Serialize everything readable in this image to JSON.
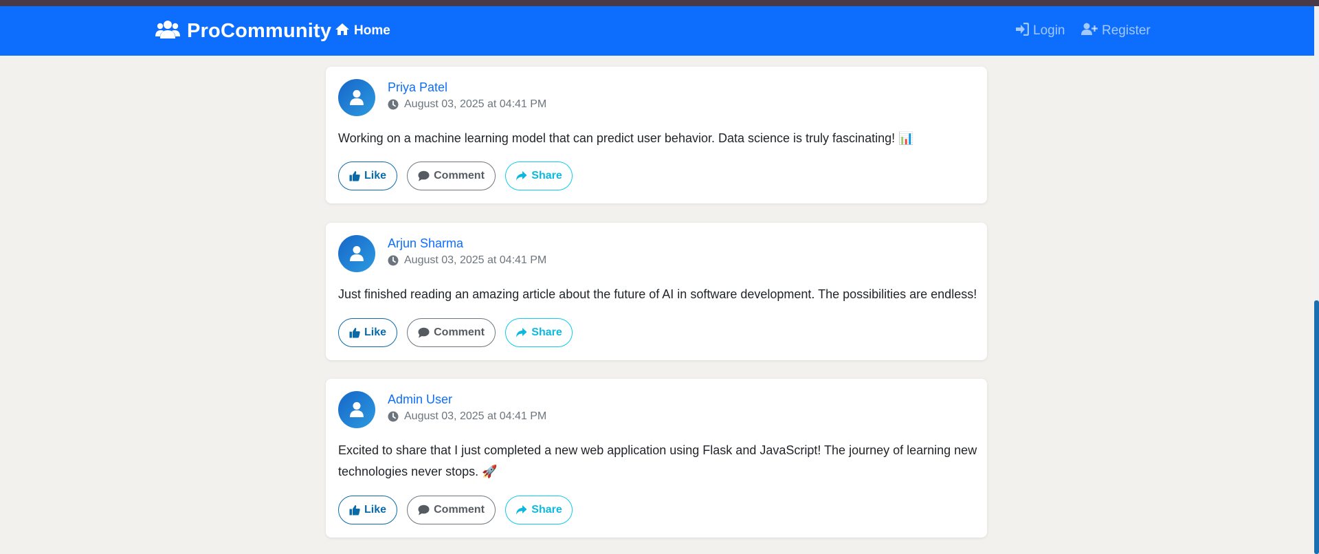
{
  "navbar": {
    "brand": "ProCommunity",
    "home": "Home",
    "login": "Login",
    "register": "Register",
    "brand_icon": "users-icon",
    "home_icon": "house-icon",
    "login_icon": "sign-in-icon",
    "register_icon": "user-plus-icon"
  },
  "actions": {
    "like": "Like",
    "comment": "Comment",
    "share": "Share"
  },
  "posts": [
    {
      "author": "Priya Patel",
      "timestamp": "August 03, 2025 at 04:41 PM",
      "content": "Working on a machine learning model that can predict user behavior. Data science is truly fascinating! 📊"
    },
    {
      "author": "Arjun Sharma",
      "timestamp": "August 03, 2025 at 04:41 PM",
      "content": "Just finished reading an amazing article about the future of AI in software development. The possibilities are endless!"
    },
    {
      "author": "Admin User",
      "timestamp": "August 03, 2025 at 04:41 PM",
      "content": "Excited to share that I just completed a new web application using Flask and JavaScript! The journey of learning new technologies never stops. 🚀"
    }
  ],
  "colors": {
    "primary": "#0d6efd",
    "info": "#0dcaf0",
    "secondary": "#6c757d",
    "page_bg": "#f2f1ee"
  }
}
